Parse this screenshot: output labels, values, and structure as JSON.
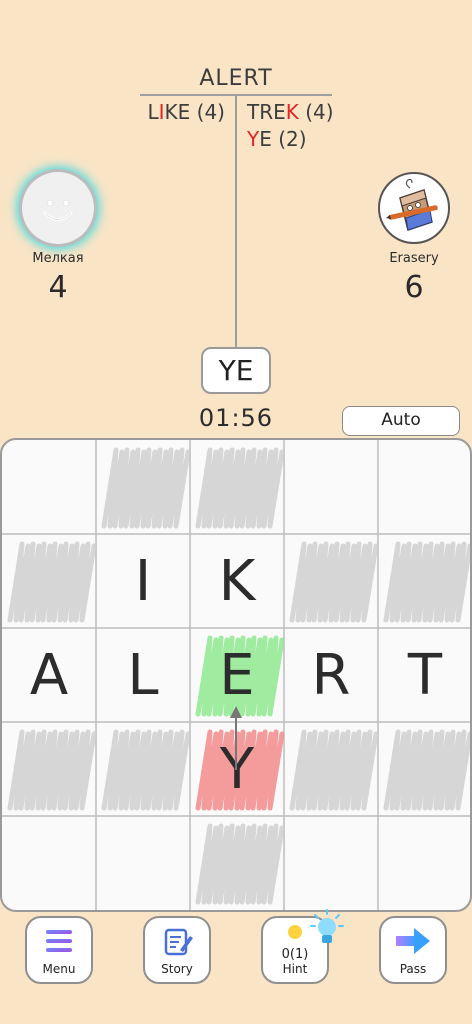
{
  "main_word": "ALERT",
  "words_left": [
    {
      "parts": [
        {
          "t": "L",
          "red": false
        },
        {
          "t": "I",
          "red": true
        },
        {
          "t": "KE (4)",
          "red": false
        }
      ]
    }
  ],
  "words_right": [
    {
      "parts": [
        {
          "t": "TRE",
          "red": false
        },
        {
          "t": "K",
          "red": true
        },
        {
          "t": " (4)",
          "red": false
        }
      ]
    },
    {
      "parts": [
        {
          "t": "Y",
          "red": true
        },
        {
          "t": "E (2)",
          "red": false
        }
      ]
    }
  ],
  "players": {
    "left": {
      "name": "Мелкая",
      "score": "4",
      "active": true,
      "avatar": "smiley-face"
    },
    "right": {
      "name": "Erasery",
      "score": "6",
      "active": false,
      "avatar": "eraser-with-pencil"
    }
  },
  "current_word": "YE",
  "timer": "01:56",
  "auto_label": "Auto",
  "board": {
    "size": 5,
    "cells": [
      [
        "",
        "",
        "",
        "",
        ""
      ],
      [
        "",
        "I",
        "K",
        "",
        ""
      ],
      [
        "A",
        "L",
        "E",
        "R",
        "T"
      ],
      [
        "",
        "",
        "Y",
        "",
        ""
      ],
      [
        "",
        "",
        "",
        "",
        ""
      ]
    ],
    "fills": [
      [
        "none",
        "gray",
        "gray",
        "none",
        "none"
      ],
      [
        "gray",
        "none",
        "none",
        "gray",
        "gray"
      ],
      [
        "none",
        "none",
        "green",
        "none",
        "none"
      ],
      [
        "gray",
        "gray",
        "red",
        "gray",
        "gray"
      ],
      [
        "none",
        "none",
        "gray",
        "none",
        "none"
      ]
    ],
    "colors": {
      "gray": "#cfcfcf",
      "green": "#8ee88e",
      "red": "#f28a8a"
    }
  },
  "toolbar": {
    "menu_label": "Menu",
    "story_label": "Story",
    "hint_count": "0(1)",
    "hint_label": "Hint",
    "pass_label": "Pass"
  }
}
